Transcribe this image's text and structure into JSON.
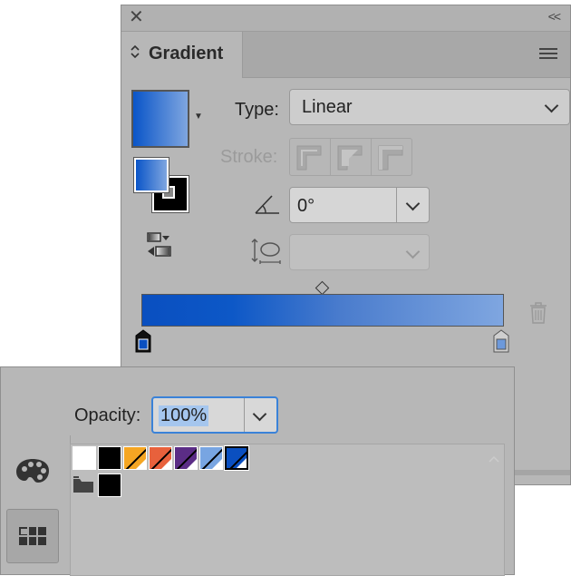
{
  "gradient_panel": {
    "tab_label": "Gradient",
    "type_label": "Type:",
    "type_value": "Linear",
    "stroke_label": "Stroke:",
    "angle_value": "0°",
    "aspect_value": "",
    "colors": {
      "gradient_start": "#0a4fc0",
      "gradient_end": "#7fa6e0",
      "start_stop": "#0a4fc0",
      "end_stop": "#6d99db"
    },
    "icons": [
      "close-icon",
      "collapse-icon",
      "panel-menu-icon",
      "reverse-gradient-icon",
      "angle-icon",
      "aspect-ratio-icon",
      "delete-stop-icon"
    ]
  },
  "swatches_panel": {
    "opacity_label": "Opacity:",
    "opacity_value": "100%",
    "swatches": [
      {
        "color": "#ffffff",
        "slash": false
      },
      {
        "color": "#000000",
        "slash": false
      },
      {
        "color": "#f5a623",
        "slash": true
      },
      {
        "color": "#e8613c",
        "slash": true
      },
      {
        "color": "#5b2d86",
        "slash": true
      },
      {
        "color": "#78a5e2",
        "slash": true
      },
      {
        "color": "#0a4fc0",
        "slash": true,
        "selected": true
      }
    ],
    "group_swatches": [
      {
        "color": "#000000"
      }
    ],
    "icons": [
      "palette-icon",
      "swatch-grid-view-icon",
      "folder-icon"
    ]
  }
}
